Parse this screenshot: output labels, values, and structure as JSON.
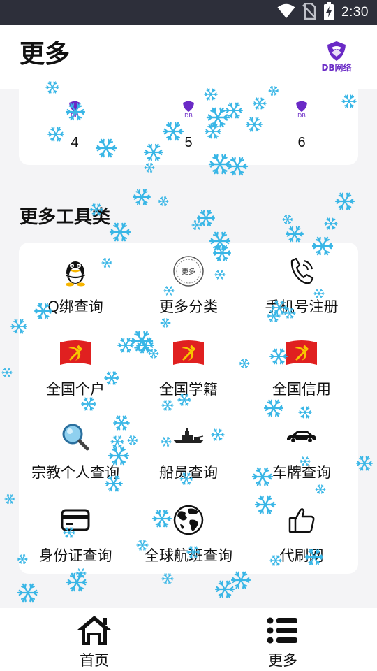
{
  "status_bar": {
    "time": "2:30",
    "icons": [
      "wifi-icon",
      "no-sim-icon",
      "battery-charging-icon"
    ]
  },
  "header": {
    "title": "更多",
    "brand": "DB网络"
  },
  "top_items": [
    {
      "label": "4",
      "logo_text": "DB网络"
    },
    {
      "label": "5",
      "logo_text": "DB网络"
    },
    {
      "label": "6",
      "logo_text": "DB网络"
    }
  ],
  "section": {
    "title": "更多工具类",
    "items": [
      {
        "label": "Q绑查询",
        "icon": "qq-penguin-icon"
      },
      {
        "label": "更多分类",
        "icon": "more-stamp-icon",
        "icon_text": "更多"
      },
      {
        "label": "手机号注册",
        "icon": "phone-icon"
      },
      {
        "label": "全国个户",
        "icon": "hammer-sickle-flag-icon"
      },
      {
        "label": "全国学籍",
        "icon": "hammer-sickle-flag-icon"
      },
      {
        "label": "全国信用",
        "icon": "hammer-sickle-flag-icon"
      },
      {
        "label": "宗教个人查询",
        "icon": "magnifier-icon"
      },
      {
        "label": "船员查询",
        "icon": "warship-icon"
      },
      {
        "label": "车牌查询",
        "icon": "car-icon"
      },
      {
        "label": "身份证查询",
        "icon": "id-card-icon"
      },
      {
        "label": "全球航班查询",
        "icon": "globe-icon"
      },
      {
        "label": "代刷网",
        "icon": "thumbs-up-icon"
      }
    ]
  },
  "bottom_nav": [
    {
      "label": "首页",
      "icon": "home-icon"
    },
    {
      "label": "更多",
      "icon": "list-icon"
    }
  ],
  "colors": {
    "status_bar_bg": "#2d2f3a",
    "page_bg": "#f4f4f6",
    "brand_purple": "#6a2ac6",
    "flag_red": "#e02020",
    "flag_yellow": "#f7c600",
    "snowflake": "#39b6e6"
  }
}
